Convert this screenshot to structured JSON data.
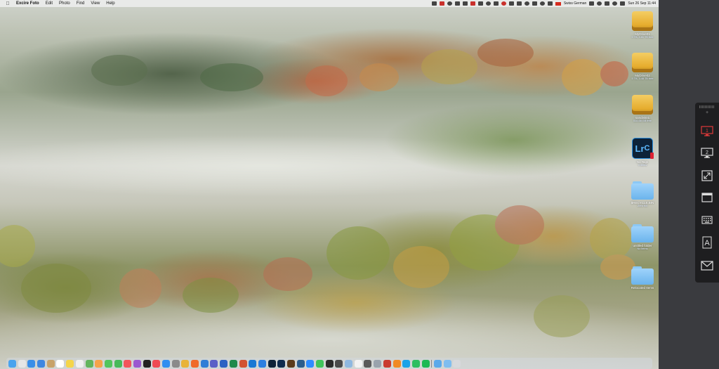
{
  "menubar": {
    "apple_icon": "apple-logo",
    "app_name": "Excire Foto",
    "menus": [
      "Edit",
      "Photo",
      "Find",
      "View",
      "Help"
    ],
    "status_icons": [
      "wifi-icon",
      "battery-icon",
      "bluetooth-icon",
      "dropbox-icon",
      "cloud-icon",
      "control-center-icon"
    ],
    "user": "Swiss German",
    "clock": "Sun 26 Sep 11:44"
  },
  "desktop": {
    "items": [
      {
        "label": "MyDrive01",
        "sub": "5 TB, 3.81 TB free",
        "kind": "drive"
      },
      {
        "label": "MyDrive02",
        "sub": "5 TB, 3.48 TB free",
        "kind": "drive"
      },
      {
        "label": "sandisk01",
        "sub": "510.38 GB free",
        "kind": "drive"
      },
      {
        "label": "No Tags",
        "sub": "4 items",
        "kind": "lightroom"
      },
      {
        "label": "$RECYCLE.BIN",
        "sub": "Zero KB",
        "kind": "folder"
      },
      {
        "label": "untitled folder",
        "sub": "No items",
        "kind": "folder"
      },
      {
        "label": "Relocated Items",
        "sub": "",
        "kind": "folder"
      }
    ]
  },
  "dock": {
    "apps": [
      {
        "name": "finder",
        "color": "#4aa3ee"
      },
      {
        "name": "launchpad",
        "color": "#e6e6e6"
      },
      {
        "name": "safari",
        "color": "#3a8ee8"
      },
      {
        "name": "mail",
        "color": "#3f87e0"
      },
      {
        "name": "contacts",
        "color": "#c8a36a"
      },
      {
        "name": "calendar",
        "color": "#ffffff"
      },
      {
        "name": "notes",
        "color": "#f5d54a"
      },
      {
        "name": "reminders",
        "color": "#f0f0f0"
      },
      {
        "name": "maps",
        "color": "#62b45d"
      },
      {
        "name": "photos",
        "color": "#f5a34a"
      },
      {
        "name": "messages",
        "color": "#52c55d"
      },
      {
        "name": "facetime",
        "color": "#47b95a"
      },
      {
        "name": "music",
        "color": "#f2545b"
      },
      {
        "name": "podcasts",
        "color": "#9b59d0"
      },
      {
        "name": "tv",
        "color": "#222222"
      },
      {
        "name": "news",
        "color": "#ef4a53"
      },
      {
        "name": "app-store",
        "color": "#2f8ff0"
      },
      {
        "name": "system-preferences",
        "color": "#8a8a8a"
      },
      {
        "name": "chrome",
        "color": "#e8b33a"
      },
      {
        "name": "firefox",
        "color": "#f06a2a"
      },
      {
        "name": "vscode",
        "color": "#2f7ed6"
      },
      {
        "name": "teams",
        "color": "#5b5fc7"
      },
      {
        "name": "word",
        "color": "#2b62c3"
      },
      {
        "name": "excel",
        "color": "#1f8a4c"
      },
      {
        "name": "powerpoint",
        "color": "#d35230"
      },
      {
        "name": "outlook",
        "color": "#1a78d4"
      },
      {
        "name": "onedrive",
        "color": "#2d7fe0"
      },
      {
        "name": "lightroom",
        "color": "#0d2238"
      },
      {
        "name": "photoshop",
        "color": "#0e2b4d"
      },
      {
        "name": "bridge",
        "color": "#5a3b1b"
      },
      {
        "name": "excire",
        "color": "#2b5d8c"
      },
      {
        "name": "zoom",
        "color": "#2d8cff"
      },
      {
        "name": "whatsapp",
        "color": "#3fc35a"
      },
      {
        "name": "terminal",
        "color": "#2b2b2b"
      },
      {
        "name": "activity-monitor",
        "color": "#4a4a4a"
      },
      {
        "name": "preview",
        "color": "#8fb8e0"
      },
      {
        "name": "textedit",
        "color": "#f2f2f2"
      },
      {
        "name": "calculator",
        "color": "#5a5a5a"
      },
      {
        "name": "disk-utility",
        "color": "#9aa3ad"
      },
      {
        "name": "filezilla",
        "color": "#c93a2f"
      },
      {
        "name": "vlc",
        "color": "#f08a24"
      },
      {
        "name": "skype",
        "color": "#1aa3e8"
      },
      {
        "name": "evernote",
        "color": "#2dbe60"
      },
      {
        "name": "spotify",
        "color": "#1db954"
      },
      {
        "name": "downloads",
        "color": "#5aa9ea"
      },
      {
        "name": "documents",
        "color": "#7fbdf0"
      },
      {
        "name": "trash",
        "color": "#d7d9dc"
      }
    ]
  },
  "side_panel": {
    "buttons": [
      "display-1",
      "display-2",
      "expand",
      "window",
      "keyboard",
      "text-a",
      "mail"
    ],
    "display_one_label": "1",
    "display_two_label": "2",
    "text_label": "A"
  }
}
